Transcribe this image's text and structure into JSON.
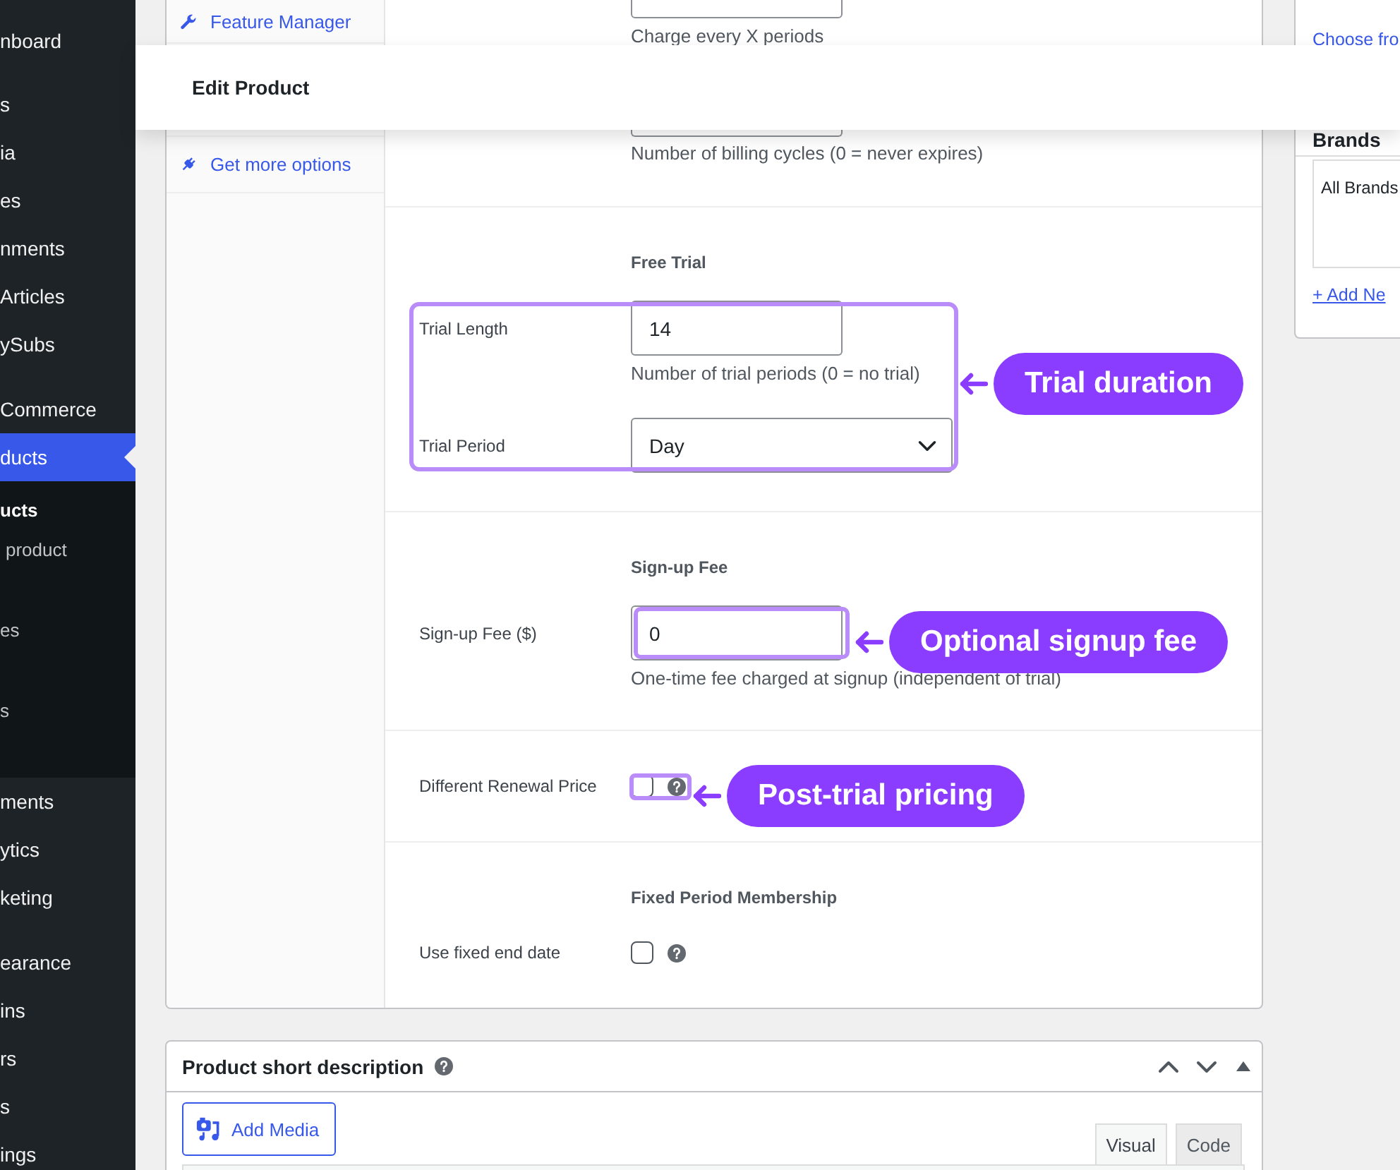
{
  "admin_menu": {
    "items": [
      {
        "label": "nboard",
        "selected": false
      },
      {
        "label": "s",
        "selected": false
      },
      {
        "label": "ia",
        "selected": false
      },
      {
        "label": "es",
        "selected": false
      },
      {
        "label": "nments",
        "selected": false
      },
      {
        "label": "Articles",
        "selected": false
      },
      {
        "label": "ySubs",
        "selected": false
      },
      {
        "label": "Commerce",
        "selected": false
      },
      {
        "label": "ducts",
        "selected": true,
        "children": [
          {
            "label": "ucts",
            "selected": true
          },
          {
            "label": "product",
            "selected": false
          },
          {
            "label": "es",
            "selected": false
          },
          {
            "label": "s",
            "selected": false
          }
        ]
      },
      {
        "label": "ments",
        "selected": false
      },
      {
        "label": "ytics",
        "selected": false
      },
      {
        "label": "keting",
        "selected": false
      },
      {
        "label": "earance",
        "selected": false
      },
      {
        "label": "ins",
        "selected": false
      },
      {
        "label": "rs",
        "selected": false
      },
      {
        "label": "s",
        "selected": false
      },
      {
        "label": "ings",
        "selected": false
      }
    ]
  },
  "header": {
    "title": "Edit Product"
  },
  "product_tabs": [
    {
      "label": "Feature Manager"
    },
    {
      "label": "Get more options"
    }
  ],
  "billing_fields": [
    {
      "help": "Charge every X periods"
    },
    {
      "help": "Number of billing cycles (0 = never expires)"
    }
  ],
  "sections": [
    {
      "heading": "Free Trial",
      "fields": [
        {
          "kind": "text",
          "label": "Trial Length",
          "value": "14",
          "help": "Number of trial periods (0 = no trial)"
        },
        {
          "kind": "select",
          "label": "Trial Period",
          "value": "Day"
        }
      ],
      "annotation": {
        "text": "Trial duration"
      }
    },
    {
      "heading": "Sign-up Fee",
      "fields": [
        {
          "kind": "text",
          "label": "Sign-up Fee ($)",
          "value": "0",
          "help": "One-time fee charged at signup (independent of trial)",
          "annotation": {
            "text": "Optional signup fee"
          }
        }
      ]
    },
    {
      "fields": [
        {
          "kind": "checkbox",
          "label": "Different Renewal Price",
          "checked": false,
          "annotation": {
            "text": "Post-trial pricing"
          }
        }
      ]
    },
    {
      "heading": "Fixed Period Membership",
      "fields": [
        {
          "kind": "checkbox",
          "label": "Use fixed end date",
          "checked": false
        }
      ]
    }
  ],
  "right_sidebar": {
    "image_link": "Choose fro",
    "brands": {
      "title": "Brands",
      "items": [
        "All Brands"
      ],
      "add_link": "+ Add Ne"
    }
  },
  "short_description": {
    "title": "Product short description",
    "add_media": "Add Media",
    "tabs": [
      {
        "label": "Visual",
        "selected": true
      },
      {
        "label": "Code",
        "selected": false
      }
    ]
  }
}
